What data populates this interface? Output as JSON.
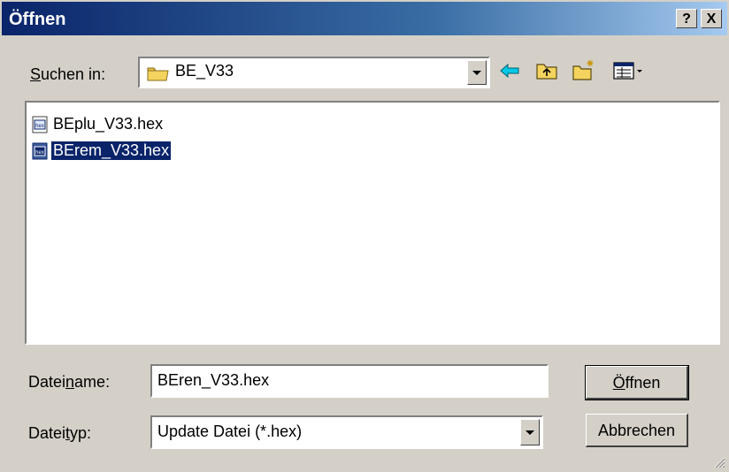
{
  "window": {
    "title": "Öffnen",
    "help_label": "?",
    "close_label": "X"
  },
  "lookin": {
    "label_prefix": "",
    "label_accel": "S",
    "label_rest": "uchen in:",
    "value": "BE_V33"
  },
  "files": [
    {
      "name": "BEplu_V33.hex",
      "selected": false
    },
    {
      "name": "BErem_V33.hex",
      "selected": true
    }
  ],
  "filename": {
    "label_pre": "Datei",
    "label_accel": "n",
    "label_post": "ame:",
    "value": "BEren_V33.hex"
  },
  "filetype": {
    "label_pre": "Datei",
    "label_accel": "t",
    "label_post": "yp:",
    "value": "Update Datei (*.hex)"
  },
  "buttons": {
    "open_pre": "",
    "open_accel": "Ö",
    "open_post": "ffnen",
    "cancel": "Abbrechen"
  },
  "colors": {
    "titlebar_start": "#0a246a",
    "titlebar_end": "#a6caf0",
    "selection": "#0a246a",
    "dialog_bg": "#d4d0c8"
  }
}
